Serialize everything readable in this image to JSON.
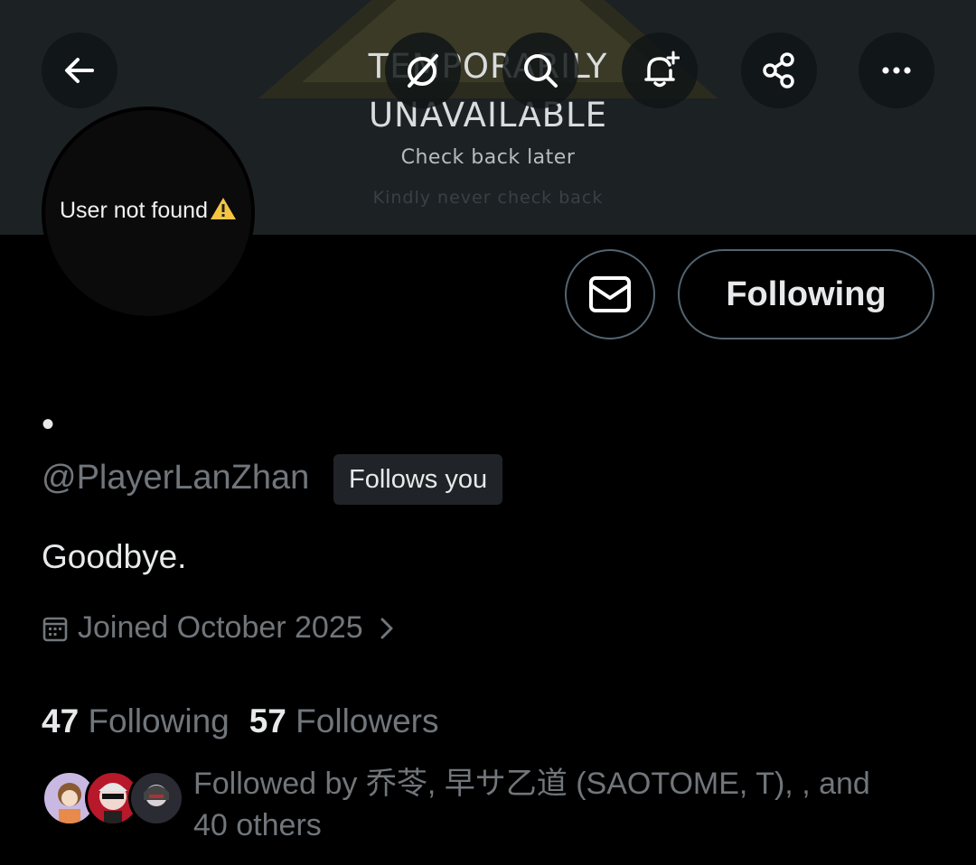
{
  "header": {
    "banner_lines": [
      "TEMPORARILY",
      "UNAVAILABLE",
      "Check back later",
      "Kindly never check back"
    ],
    "nav_icons": [
      "back-arrow-icon",
      "grok-icon",
      "search-icon",
      "bell-plus-icon",
      "share-icon",
      "more-icon"
    ]
  },
  "profile": {
    "avatar_text": "User not found",
    "message_icon": "envelope-icon",
    "following_button": "Following",
    "display_name": "•",
    "handle": "@PlayerLanZhan",
    "follows_you_badge": "Follows you",
    "bio": "Goodbye.",
    "joined": "Joined October 2025",
    "following_count": "47",
    "following_label": "Following",
    "followers_count": "57",
    "followers_label": "Followers",
    "followed_by_line1": "Followed by 乔苓, 早サ乙道 (SAOTOME, T), , and",
    "followed_by_line2": "40 others"
  },
  "colors": {
    "background": "#000000",
    "text_primary": "#e7e9ea",
    "text_secondary": "#71767b",
    "border": "#536471",
    "badge_bg": "#202327",
    "banner_bg": "#1c2124"
  }
}
